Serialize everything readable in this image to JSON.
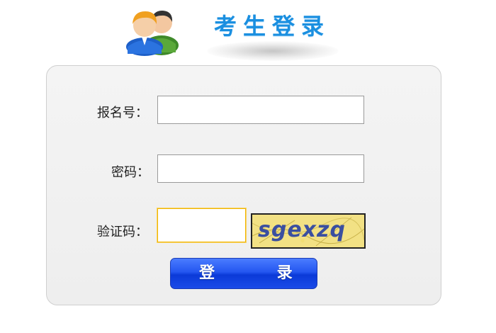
{
  "header": {
    "title": "考生登录",
    "icon": "users-icon"
  },
  "form": {
    "registration_label": "报名号：",
    "registration_value": "",
    "password_label": "密码：",
    "password_value": "",
    "captcha_label": "验证码：",
    "captcha_value": "",
    "captcha_image_text": "sgexzq"
  },
  "buttons": {
    "login_label": "登 录"
  },
  "colors": {
    "title": "#1a8fe0",
    "button": "#2456f0",
    "captcha_background": "#f2e184"
  }
}
